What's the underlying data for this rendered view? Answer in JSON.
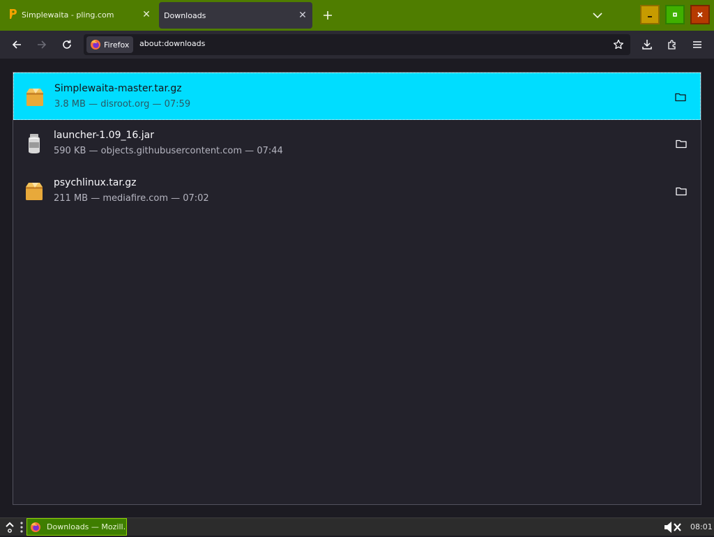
{
  "tabs": [
    {
      "label": "Simplewaita - pling.com",
      "icon": "pling-icon"
    },
    {
      "label": "Downloads",
      "active": true
    }
  ],
  "toolbar": {
    "identity_label": "Firefox",
    "url": "about:downloads"
  },
  "downloads": [
    {
      "name": "Simplewaita-master.tar.gz",
      "meta": "3.8 MB — disroot.org — 07:59",
      "icon": "archive-icon",
      "selected": true
    },
    {
      "name": "launcher-1.09_16.jar",
      "meta": "590 KB — objects.githubusercontent.com — 07:44",
      "icon": "jar-icon"
    },
    {
      "name": "psychlinux.tar.gz",
      "meta": "211 MB — mediafire.com — 07:02",
      "icon": "archive-icon"
    }
  ],
  "taskbar": {
    "task_label": "Downloads — Mozill…",
    "clock": "08:01"
  },
  "colors": {
    "tabstrip": "#4f7d00",
    "selected_row": "#00ddff",
    "background": "#1c1b22"
  }
}
